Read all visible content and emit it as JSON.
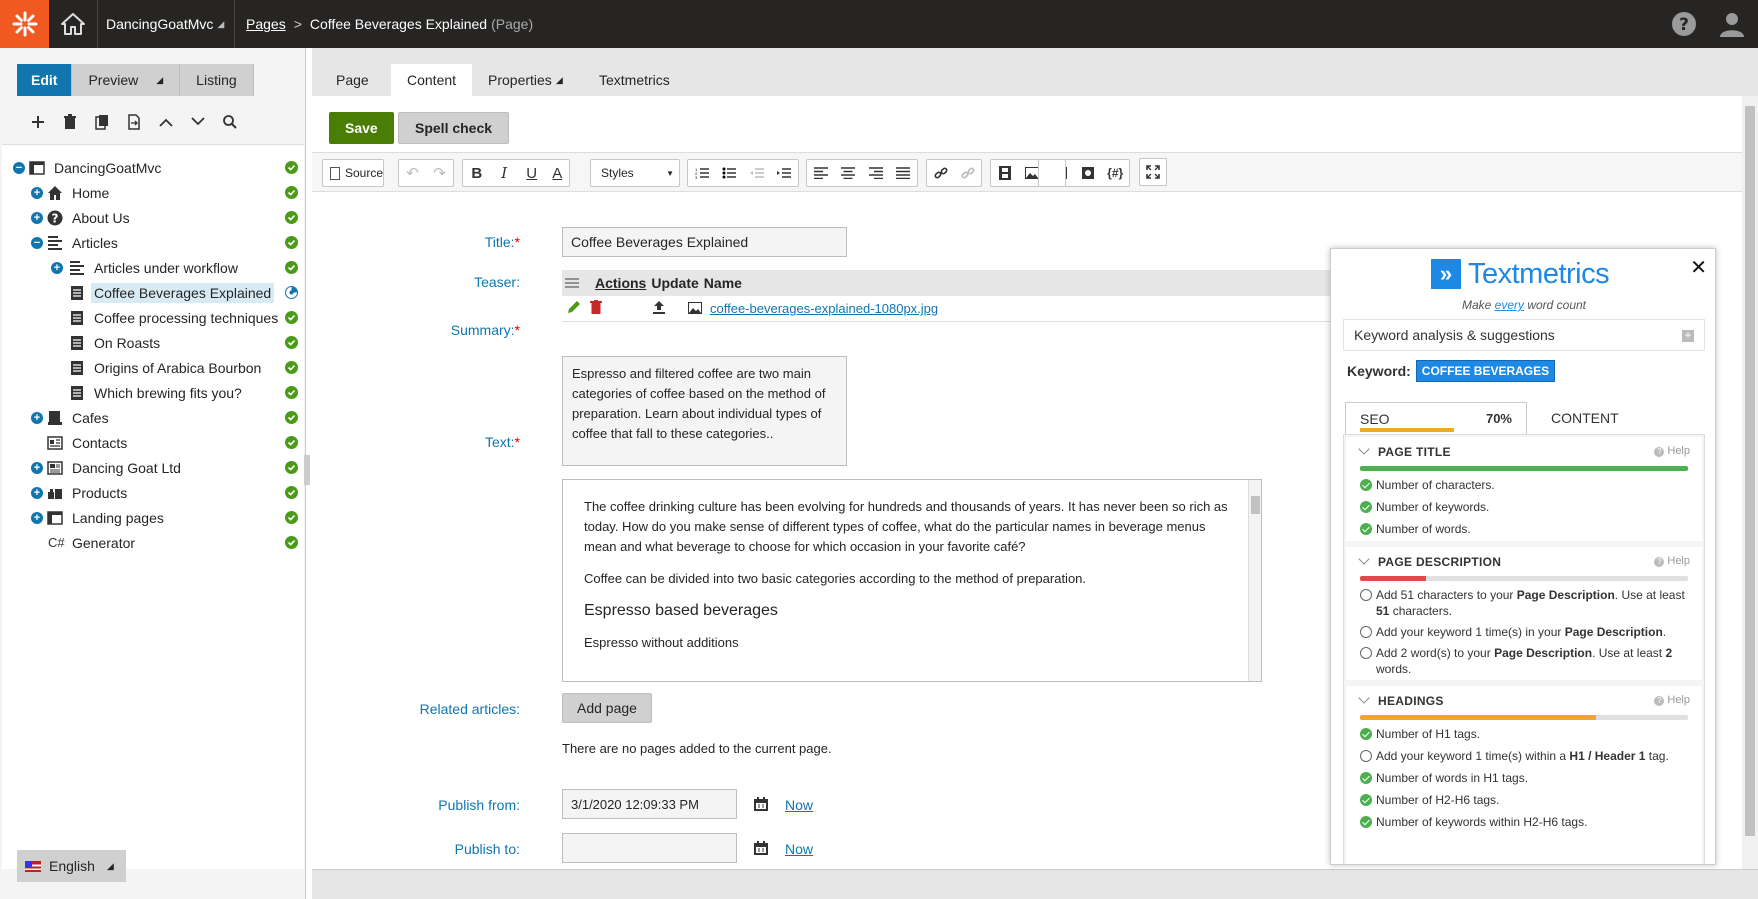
{
  "header": {
    "site_name": "DancingGoatMvc",
    "breadcrumb_root": "Pages",
    "breadcrumb_sep": ">",
    "page_name": "Coffee Beverages Explained",
    "page_kind": "(Page)"
  },
  "mode_tabs": {
    "edit": "Edit",
    "preview": "Preview",
    "listing": "Listing"
  },
  "tree": {
    "root": "DancingGoatMvc",
    "items": [
      {
        "label": "Home"
      },
      {
        "label": "About Us"
      },
      {
        "label": "Articles"
      },
      {
        "label": "Articles under workflow"
      },
      {
        "label": "Coffee Beverages Explained"
      },
      {
        "label": "Coffee processing techniques"
      },
      {
        "label": "On Roasts"
      },
      {
        "label": "Origins of Arabica Bourbon"
      },
      {
        "label": "Which brewing fits you?"
      },
      {
        "label": "Cafes"
      },
      {
        "label": "Contacts"
      },
      {
        "label": "Dancing Goat Ltd"
      },
      {
        "label": "Products"
      },
      {
        "label": "Landing pages"
      },
      {
        "label": "Generator"
      }
    ]
  },
  "language": "English",
  "content_tabs": {
    "page": "Page",
    "content": "Content",
    "properties": "Properties",
    "textmetrics": "Textmetrics"
  },
  "actions": {
    "save": "Save",
    "spell_check": "Spell check"
  },
  "editor_toolbar": {
    "source": "Source",
    "styles": "Styles",
    "var": "{#}"
  },
  "form": {
    "title_label": "Title:",
    "title_value": "Coffee Beverages Explained",
    "teaser_label": "Teaser:",
    "teaser_cols": {
      "actions": "Actions",
      "update": "Update",
      "name": "Name"
    },
    "teaser_file": "coffee-beverages-explained-1080px.jpg",
    "summary_label": "Summary:",
    "summary_value": "Espresso and filtered coffee are two main categories of coffee based on the method of preparation. Learn about individual types of coffee that fall to these categories..",
    "text_label": "Text:",
    "text_p1": "The coffee drinking culture has been evolving for hundreds and thousands of years. It has never been so rich as today. How do you make sense of different types of coffee, what do the particular names in beverage menus mean and what beverage to choose for which occasion in your favorite café?",
    "text_p2": "Coffee can be divided into two basic categories according to the method of preparation.",
    "text_h2": "Espresso based beverages",
    "text_p3": "Espresso without additions",
    "related_label": "Related articles:",
    "add_page": "Add page",
    "no_pages": "There are no pages added to the current page.",
    "publish_from_label": "Publish from:",
    "publish_from_value": "3/1/2020 12:09:33 PM",
    "publish_to_label": "Publish to:",
    "publish_to_value": "",
    "now": "Now"
  },
  "textmetrics": {
    "brand": "Textmetrics",
    "tagline_pre": "Make ",
    "tagline_em": "every",
    "tagline_post": " word count",
    "section_title": "Keyword analysis & suggestions",
    "keyword_label": "Keyword:",
    "keyword_value": "COFFEE BEVERAGES",
    "tab_seo": "SEO",
    "tab_seo_pct": "70%",
    "tab_seo_score": 0.7,
    "tab_content": "CONTENT",
    "help": "Help",
    "page_title": {
      "heading": "PAGE TITLE",
      "progress": 1.0,
      "color": "#4caf50",
      "items": [
        "Number of characters.",
        "Number of keywords.",
        "Number of words."
      ]
    },
    "page_description": {
      "heading": "PAGE DESCRIPTION",
      "progress": 0.2,
      "color": "#e04a4a",
      "item1_a": "Add 51 characters to your ",
      "item1_b": "Page Description",
      "item1_c": ". Use at least ",
      "item1_d": "51",
      "item1_e": " characters.",
      "item2_a": "Add your keyword 1 time(s) in your ",
      "item2_b": "Page Description",
      "item2_c": ".",
      "item3_a": "Add 2 word(s) to your ",
      "item3_b": "Page Description",
      "item3_c": ". Use at least ",
      "item3_d": "2",
      "item3_e": " words."
    },
    "headings": {
      "heading": "HEADINGS",
      "progress": 0.72,
      "color": "#f5a623",
      "item1": "Number of H1 tags.",
      "item2_a": "Add your keyword 1 time(s) within a ",
      "item2_b": "H1 / Header 1",
      "item2_c": " tag.",
      "item3": "Number of words in H1 tags.",
      "item4": "Number of H2-H6 tags.",
      "item5": "Number of keywords within H2-H6 tags."
    }
  },
  "colors": {
    "accent": "#1175ae",
    "save": "#497d04",
    "logo": "#f05a22",
    "header": "#262524",
    "status_ok": "#4a9b18"
  }
}
